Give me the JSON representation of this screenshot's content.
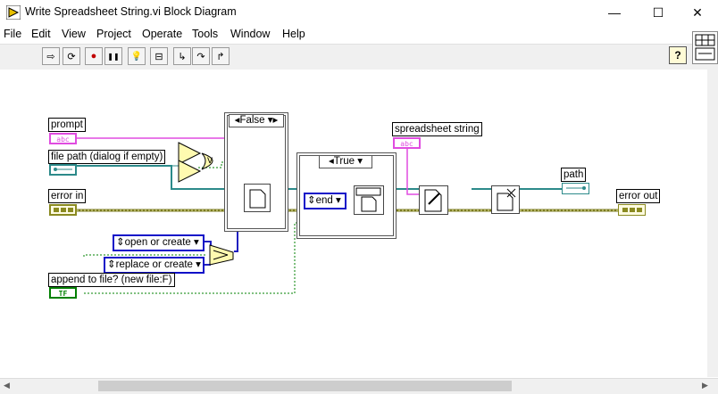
{
  "window": {
    "title": "Write Spreadsheet String.vi Block Diagram",
    "minimize": "—",
    "maximize": "☐",
    "close": "✕"
  },
  "menu": [
    "File",
    "Edit",
    "View",
    "Project",
    "Operate",
    "Tools",
    "Window",
    "Help"
  ],
  "toolbar": {
    "run": "⇨",
    "run_continuously": "⟳",
    "abort": "●",
    "pause": "❚❚",
    "highlight": "💡",
    "retain": "⊟",
    "step_into": "↳",
    "step_over": "↷",
    "step_out": "↱",
    "help": "?"
  },
  "diagram": {
    "labels": {
      "prompt": "prompt",
      "file_path": "file path (dialog if empty)",
      "error_in": "error in",
      "append": "append to file? (new file:F)",
      "spreadsheet_string": "spreadsheet string",
      "path": "path",
      "error_out": "error out"
    },
    "terminals": {
      "prompt": "abc",
      "spreadsheet_string": "abc",
      "append": "TF"
    },
    "rings": {
      "open_or_create": "open or create",
      "replace_or_create": "replace or create",
      "end": "end"
    },
    "cases": {
      "false_case": "False",
      "true_case": "True"
    }
  }
}
